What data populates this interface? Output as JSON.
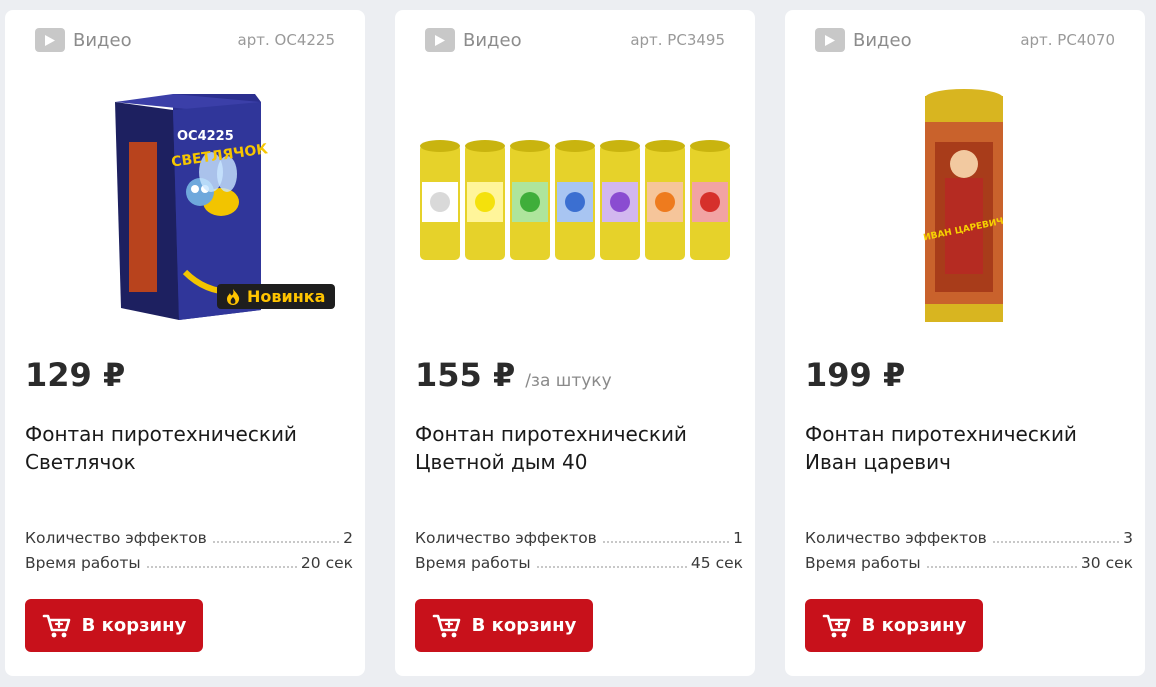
{
  "products": [
    {
      "video_label": "Видео",
      "sku": "арт. ОС4225",
      "badge": "Новинка",
      "price": "129 ₽",
      "price_unit": "",
      "title_line1": "Фонтан пиротехнический",
      "title_line2": "Светлячок",
      "specs": [
        {
          "label": "Количество эффектов",
          "value": "2"
        },
        {
          "label": "Время работы",
          "value": "20 сек"
        }
      ],
      "cart_label": "В корзину",
      "image_text_box": "ОС4225",
      "image_text_brand": "СВЕТЛЯЧОК"
    },
    {
      "video_label": "Видео",
      "sku": "арт. РС3495",
      "price": "155 ₽",
      "price_unit": "/за штуку",
      "title_line1": "Фонтан пиротехнический",
      "title_line2": "Цветной дым 40",
      "specs": [
        {
          "label": "Количество эффектов",
          "value": "1"
        },
        {
          "label": "Время работы",
          "value": "45 сек"
        }
      ],
      "cart_label": "В корзину"
    },
    {
      "video_label": "Видео",
      "sku": "арт. РС4070",
      "price": "199 ₽",
      "price_unit": "",
      "title_line1": "Фонтан пиротехнический",
      "title_line2": "Иван царевич",
      "specs": [
        {
          "label": "Количество эффектов",
          "value": "3"
        },
        {
          "label": "Время работы",
          "value": "30 сек"
        }
      ],
      "cart_label": "В корзину",
      "image_text_brand": "ИВАН ЦАРЕВИЧ"
    }
  ],
  "colors": {
    "accent": "#c8111b",
    "badge_bg": "#1e1e1e",
    "badge_text": "#ffc400",
    "page_bg": "#eceef2"
  },
  "icons": [
    "play-icon",
    "fire-icon",
    "cart-icon"
  ]
}
